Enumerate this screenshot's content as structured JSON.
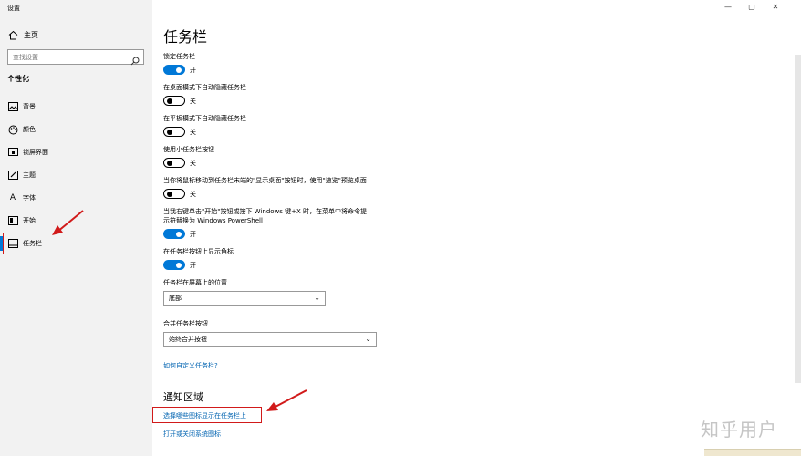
{
  "window": {
    "title": "设置",
    "controls": {
      "minimize": "—",
      "maximize": "▢",
      "close": "✕"
    }
  },
  "sidebar": {
    "home_label": "主页",
    "search_placeholder": "查找设置",
    "section": "个性化",
    "items": [
      {
        "label": "背景",
        "icon": "image-icon"
      },
      {
        "label": "颜色",
        "icon": "palette-icon"
      },
      {
        "label": "锁屏界面",
        "icon": "lock-screen-icon"
      },
      {
        "label": "主题",
        "icon": "brush-icon"
      },
      {
        "label": "字体",
        "icon": "font-icon"
      },
      {
        "label": "开始",
        "icon": "start-icon"
      },
      {
        "label": "任务栏",
        "icon": "taskbar-icon",
        "active": true
      }
    ]
  },
  "main": {
    "title": "任务栏",
    "settings": [
      {
        "label": "锁定任务栏",
        "state": "开",
        "on": true
      },
      {
        "label": "在桌面模式下自动隐藏任务栏",
        "state": "关",
        "on": false
      },
      {
        "label": "在平板模式下自动隐藏任务栏",
        "state": "关",
        "on": false
      },
      {
        "label": "使用小任务栏按钮",
        "state": "关",
        "on": false
      },
      {
        "label": "当你将鼠标移动到任务栏末端的\"显示桌面\"按钮时，使用\"速览\"预览桌面",
        "state": "关",
        "on": false
      },
      {
        "label_line1": "当我右键单击\"开始\"按钮或按下 Windows 键+X 时，在菜单中将命令提",
        "label_line2": "示符替换为 Windows PowerShell",
        "state": "开",
        "on": true
      },
      {
        "label": "在任务栏按钮上显示角标",
        "state": "开",
        "on": true
      }
    ],
    "position": {
      "label": "任务栏在屏幕上的位置",
      "value": "底部"
    },
    "combine": {
      "label": "合并任务栏按钮",
      "value": "始终合并按钮"
    },
    "customize_link": "如何自定义任务栏?",
    "notification": {
      "title": "通知区域",
      "link1": "选择哪些图标显示在任务栏上",
      "link2": "打开或关闭系统图标"
    }
  },
  "watermark": "知乎用户",
  "colors": {
    "accent": "#0078d7",
    "annotation": "#d11a1a",
    "link": "#0063b1"
  }
}
